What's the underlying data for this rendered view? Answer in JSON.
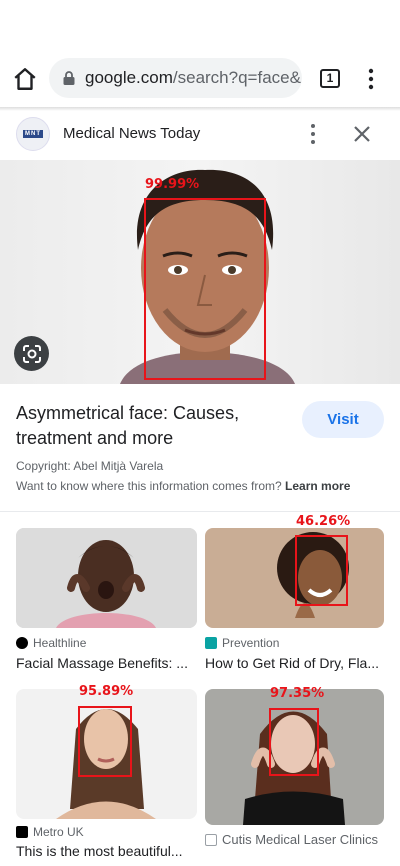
{
  "browser": {
    "url_host": "google.com",
    "url_path": "/search?q=face&",
    "tab_count": "1"
  },
  "source_header": {
    "logo_text": "MNT",
    "name": "Medical News Today"
  },
  "hero": {
    "detection_label": "99.99%"
  },
  "result": {
    "title": "Asymmetrical face: Causes, treatment and more",
    "visit_label": "Visit",
    "copyright": "Copyright: Abel Mitjà Varela",
    "info_prefix": "Want to know where this information comes from?",
    "learn_more": "Learn more"
  },
  "related": [
    {
      "source": "Healthline",
      "title": "Facial Massage Benefits: ...",
      "detection_label": "",
      "icon_color": "#000000"
    },
    {
      "source": "Prevention",
      "title": "How to Get Rid of Dry, Fla...",
      "detection_label": "46.26%",
      "icon_color": "#0aa3a3"
    },
    {
      "source": "Metro UK",
      "title": "This is the most beautiful...",
      "detection_label": "95.89%",
      "icon_color": "#000000"
    },
    {
      "source": "Cutis Medical Laser Clinics",
      "title": "",
      "detection_label": "97.35%",
      "icon_color": "#9aa0a6"
    }
  ],
  "colors": {
    "detection": "#e8141a",
    "visit_bg": "#e8f0fe",
    "visit_text": "#1a73e8"
  }
}
